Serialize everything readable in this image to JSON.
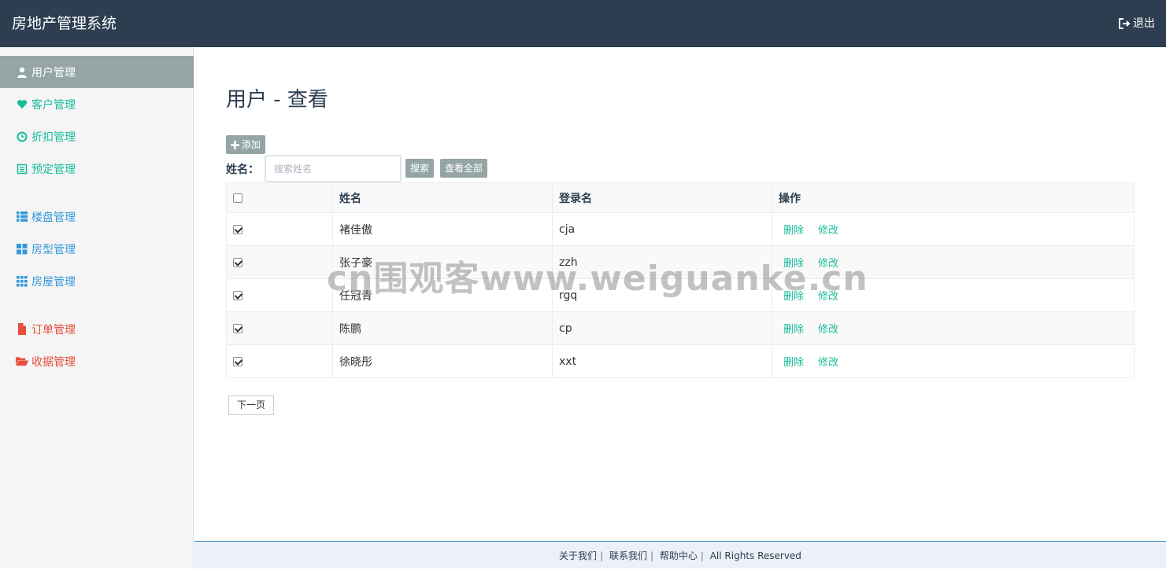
{
  "app": {
    "title": "房地产管理系统",
    "logout_label": "退出"
  },
  "sidebar": {
    "items": [
      {
        "label": "用户管理",
        "icon": "user-icon",
        "color": "#ffffff",
        "active": true
      },
      {
        "label": "客户管理",
        "icon": "heart-icon",
        "color": "#18bc9c"
      },
      {
        "label": "折扣管理",
        "icon": "clock-icon",
        "color": "#18bc9c"
      },
      {
        "label": "预定管理",
        "icon": "list-alt-icon",
        "color": "#18bc9c"
      },
      {
        "label": "楼盘管理",
        "icon": "th-list-icon",
        "color": "#3498db"
      },
      {
        "label": "房型管理",
        "icon": "th-large-icon",
        "color": "#3498db"
      },
      {
        "label": "房屋管理",
        "icon": "th-icon",
        "color": "#3498db"
      },
      {
        "label": "订单管理",
        "icon": "file-icon",
        "color": "#e74c3c"
      },
      {
        "label": "收据管理",
        "icon": "folder-open-icon",
        "color": "#e74c3c"
      }
    ]
  },
  "main": {
    "title": "用户 - 查看",
    "add_label": "添加",
    "search": {
      "label": "姓名：",
      "placeholder": "搜索姓名",
      "search_label": "搜索",
      "all_label": "查看全部"
    },
    "table": {
      "headers": [
        "",
        "姓名",
        "登录名",
        "操作"
      ],
      "rows": [
        {
          "name": "褚佳傲",
          "login": "cja",
          "checked": true
        },
        {
          "name": "张子豪",
          "login": "zzh",
          "checked": true
        },
        {
          "name": "任冠青",
          "login": "rgq",
          "checked": true
        },
        {
          "name": "陈鹏",
          "login": "cp",
          "checked": true
        },
        {
          "name": "徐晓彤",
          "login": "xxt",
          "checked": true
        }
      ],
      "delete_label": "删除",
      "edit_label": "修改"
    },
    "next_label": "下一页"
  },
  "footer": {
    "about": "关于我们",
    "contact": "联系我们",
    "help": "帮助中心",
    "rights": "All Rights Reserved"
  },
  "watermark": "cn围观客www.weiguanke.cn"
}
